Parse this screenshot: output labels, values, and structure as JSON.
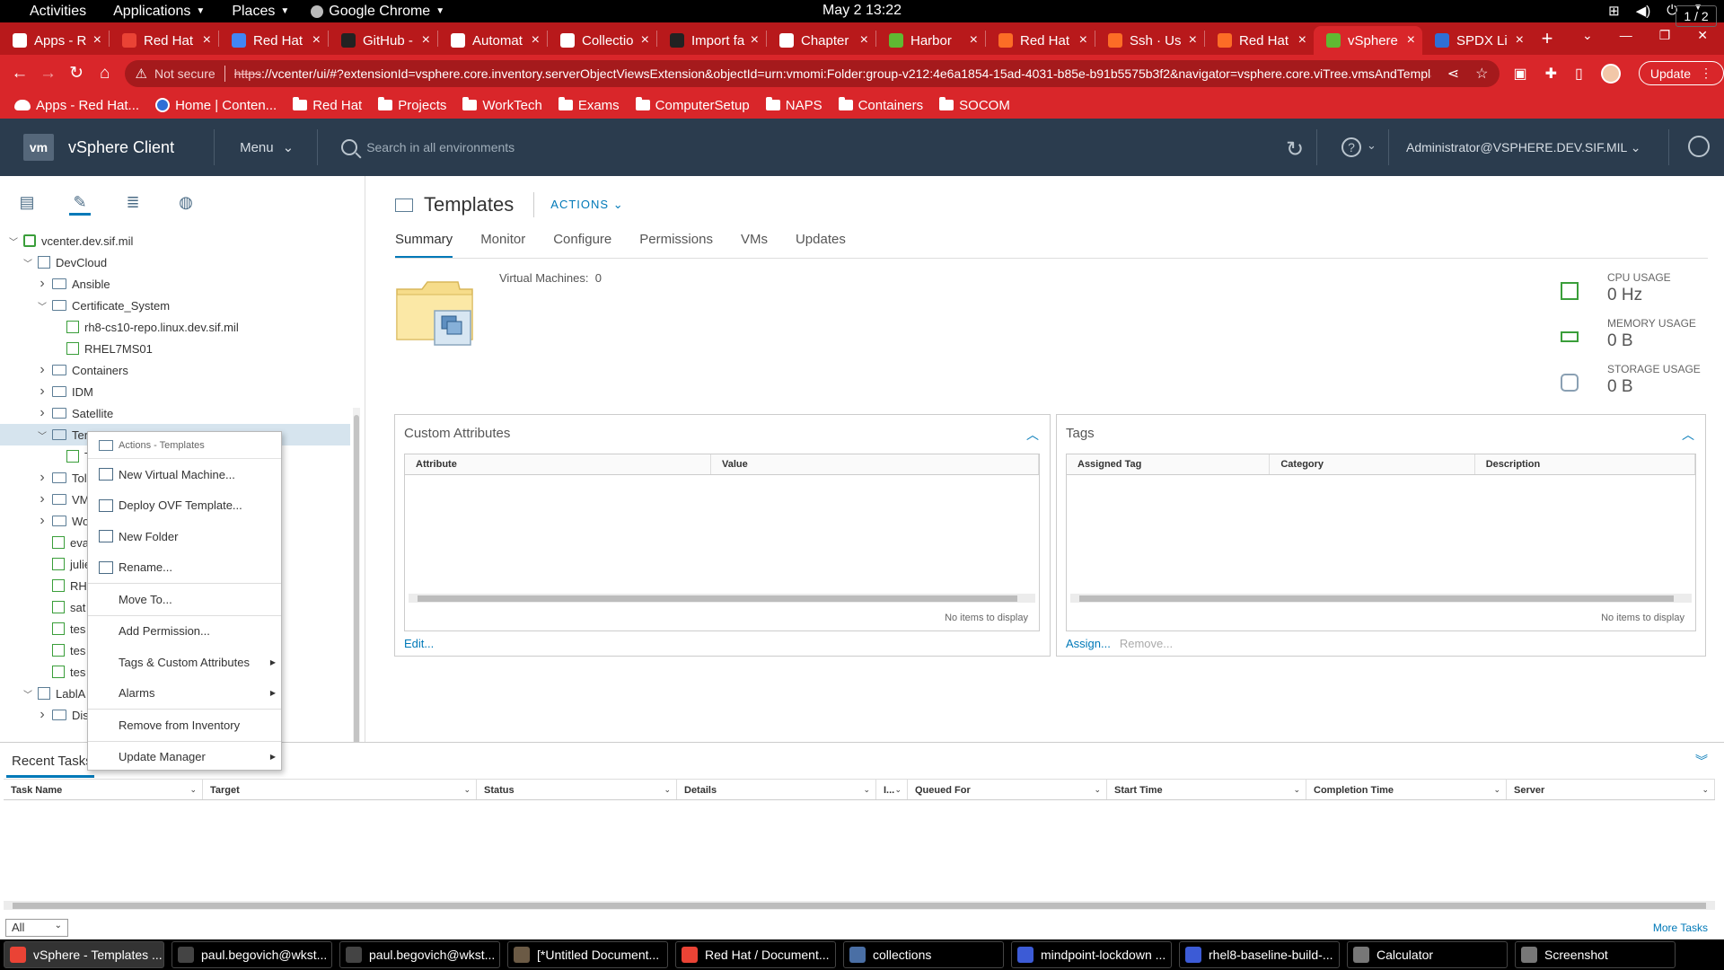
{
  "gnome": {
    "activities": "Activities",
    "applications": "Applications",
    "places": "Places",
    "chrome_app": "Google Chrome",
    "clock": "May 2  13:22"
  },
  "tabs": [
    {
      "label": "Apps - R",
      "color": "#ffffff"
    },
    {
      "label": "Red Hat",
      "color": "#ea4335"
    },
    {
      "label": "Red Hat",
      "color": "#4285f4"
    },
    {
      "label": "GitHub -",
      "color": "#222222"
    },
    {
      "label": "Automat",
      "color": "#ffffff"
    },
    {
      "label": "Collectio",
      "color": "#ffffff"
    },
    {
      "label": "Import fa",
      "color": "#222222"
    },
    {
      "label": "Chapter",
      "color": "#ffffff"
    },
    {
      "label": "Harbor",
      "color": "#60b932"
    },
    {
      "label": "Red Hat",
      "color": "#fc6d26"
    },
    {
      "label": "Ssh · Us",
      "color": "#fc6d26"
    },
    {
      "label": "Red Hat",
      "color": "#fc6d26"
    },
    {
      "label": "vSphere",
      "color": "#60b932"
    },
    {
      "label": "SPDX Li",
      "color": "#2f6fd6"
    }
  ],
  "address": {
    "not_secure": "Not secure",
    "scheme": "https",
    "url_rest": "://vcenter/ui/#?extensionId=vsphere.core.inventory.serverObjectViewsExtension&objectId=urn:vmomi:Folder:group-v212:4e6a1854-15ad-4031-b85e-b91b5575b3f2&navigator=vsphere.core.viTree.vmsAndTemplat...",
    "update_label": "Update"
  },
  "bookmarks": [
    "Apps - Red Hat...",
    "Home | Conten...",
    "Red Hat",
    "Projects",
    "WorkTech",
    "Exams",
    "ComputerSetup",
    "NAPS",
    "Containers",
    "SOCOM"
  ],
  "vsphere": {
    "logo": "vm",
    "title": "vSphere Client",
    "menu": "Menu",
    "search_placeholder": "Search in all environments",
    "user": "Administrator@VSPHERE.DEV.SIF.MIL"
  },
  "tree": [
    {
      "label": "vcenter.dev.sif.mil",
      "arrow": "open"
    },
    {
      "label": "DevCloud",
      "arrow": "open"
    },
    {
      "label": "Ansible",
      "arrow": "closed"
    },
    {
      "label": "Certificate_System",
      "arrow": "open"
    },
    {
      "label": "rh8-cs10-repo.linux.dev.sif.mil",
      "arrow": ""
    },
    {
      "label": "RHEL7MS01",
      "arrow": ""
    },
    {
      "label": "Containers",
      "arrow": "closed"
    },
    {
      "label": "IDM",
      "arrow": "closed"
    },
    {
      "label": "Satellite",
      "arrow": "closed"
    },
    {
      "label": "Ter",
      "arrow": "open"
    },
    {
      "label": "T",
      "arrow": ""
    },
    {
      "label": "Tol",
      "arrow": "closed"
    },
    {
      "label": "VM",
      "arrow": "closed"
    },
    {
      "label": "Wo",
      "arrow": "closed"
    },
    {
      "label": "eva",
      "arrow": ""
    },
    {
      "label": "julie",
      "arrow": ""
    },
    {
      "label": "RH",
      "arrow": ""
    },
    {
      "label": "sat",
      "arrow": ""
    },
    {
      "label": "tes",
      "arrow": ""
    },
    {
      "label": "tes",
      "arrow": ""
    },
    {
      "label": "tes",
      "arrow": ""
    },
    {
      "label": "LablA",
      "arrow": "open"
    },
    {
      "label": "Dis",
      "arrow": "closed"
    }
  ],
  "context_menu": {
    "header": "Actions - Templates",
    "items": [
      {
        "label": "New Virtual Machine...",
        "icon": true,
        "sub": false
      },
      {
        "label": "Deploy OVF Template...",
        "icon": true,
        "sub": false
      },
      {
        "label": "New Folder",
        "icon": true,
        "sub": false
      },
      {
        "label": "Rename...",
        "icon": true,
        "sub": false
      },
      {
        "label": "Move To...",
        "icon": false,
        "sub": false
      },
      {
        "label": "Add Permission...",
        "icon": false,
        "sub": false
      },
      {
        "label": "Tags & Custom Attributes",
        "icon": false,
        "sub": true
      },
      {
        "label": "Alarms",
        "icon": false,
        "sub": true
      },
      {
        "label": "Remove from Inventory",
        "icon": false,
        "sub": false
      },
      {
        "label": "Update Manager",
        "icon": false,
        "sub": true
      }
    ]
  },
  "main": {
    "title": "Templates",
    "actions": "ACTIONS",
    "tabs": [
      "Summary",
      "Monitor",
      "Configure",
      "Permissions",
      "VMs",
      "Updates"
    ],
    "vm_count_label": "Virtual Machines:",
    "vm_count": "0",
    "usage": [
      {
        "label": "CPU USAGE",
        "value": "0 Hz"
      },
      {
        "label": "MEMORY USAGE",
        "value": "0 B"
      },
      {
        "label": "STORAGE USAGE",
        "value": "0 B"
      }
    ],
    "custom_attributes": {
      "title": "Custom Attributes",
      "columns": [
        "Attribute",
        "Value"
      ],
      "no_items": "No items to display",
      "edit": "Edit..."
    },
    "tags": {
      "title": "Tags",
      "columns": [
        "Assigned Tag",
        "Category",
        "Description"
      ],
      "no_items": "No items to display",
      "assign": "Assign...",
      "remove": "Remove..."
    }
  },
  "recent_tasks": {
    "title": "Recent Tasks",
    "columns": [
      "Task Name",
      "Target",
      "Status",
      "Details",
      "I...",
      "Queued For",
      "Start Time",
      "Completion Time",
      "Server"
    ],
    "filter": "All",
    "more": "More Tasks"
  },
  "taskbar": [
    {
      "label": "vSphere - Templates ...",
      "color": "#ea4335"
    },
    {
      "label": "paul.begovich@wkst...",
      "color": "#444444"
    },
    {
      "label": "paul.begovich@wkst...",
      "color": "#444444"
    },
    {
      "label": "[*Untitled Document...",
      "color": "#6b5a45"
    },
    {
      "label": "Red Hat / Document...",
      "color": "#ea4335"
    },
    {
      "label": "collections",
      "color": "#4a6fa5"
    },
    {
      "label": "mindpoint-lockdown ...",
      "color": "#3c5bd6"
    },
    {
      "label": "rhel8-baseline-build-...",
      "color": "#3c5bd6"
    },
    {
      "label": "Calculator",
      "color": "#777777"
    },
    {
      "label": "Screenshot",
      "color": "#777777"
    }
  ],
  "workspace": "1 / 2"
}
